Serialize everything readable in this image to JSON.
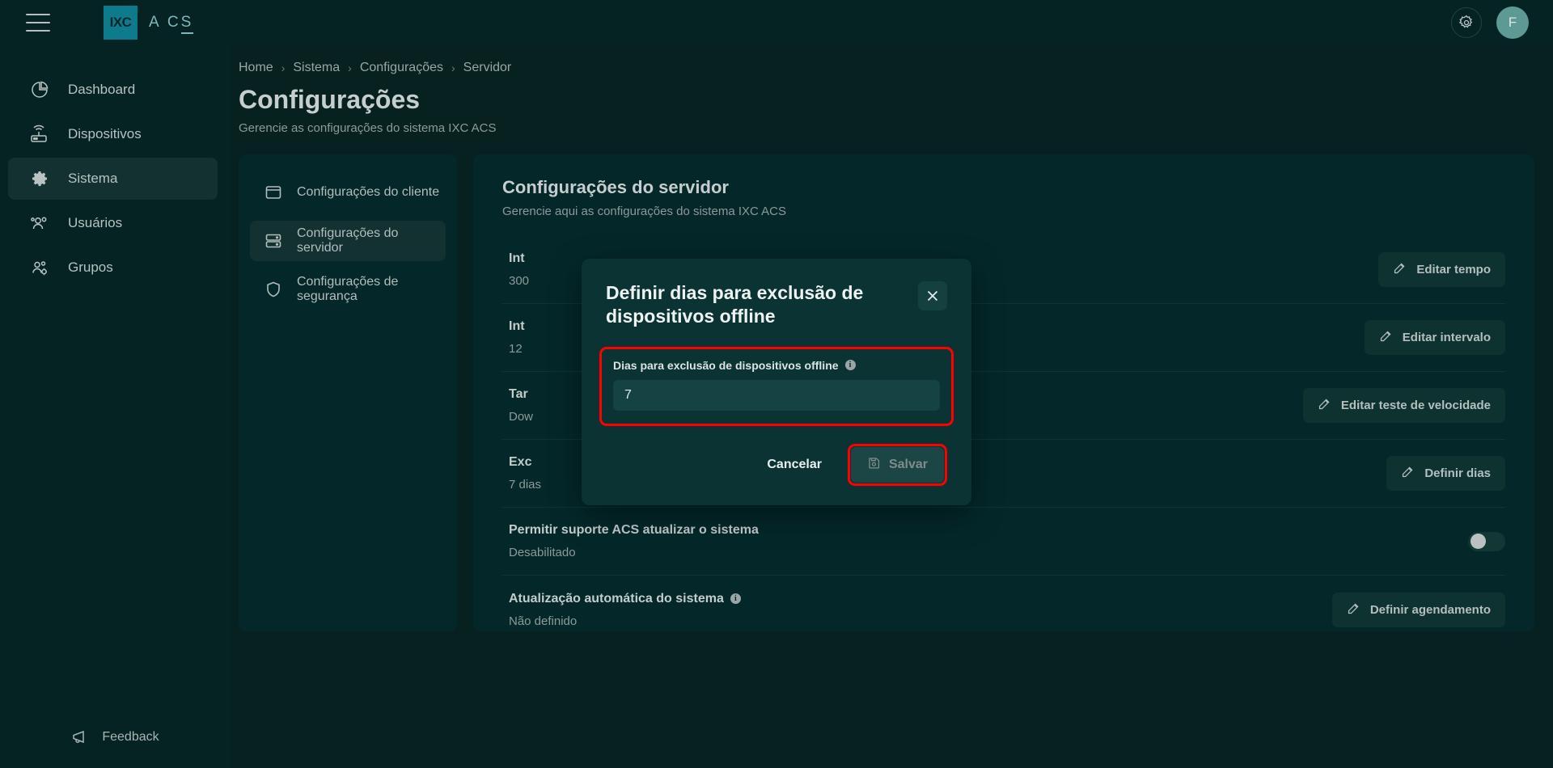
{
  "brand": {
    "logo_mark": "IXC",
    "logo_text_a": "A",
    "logo_text_b": "C",
    "logo_text_c": "S",
    "accent": "#0d7b8c"
  },
  "topbar": {
    "menu_icon": "hamburger-icon",
    "settings_icon": "gear-icon",
    "avatar_initial": "F"
  },
  "sidebar": {
    "items": [
      {
        "label": "Dashboard",
        "icon": "pie-chart-icon",
        "active": false
      },
      {
        "label": "Dispositivos",
        "icon": "router-icon",
        "active": false
      },
      {
        "label": "Sistema",
        "icon": "gear-icon",
        "active": true
      },
      {
        "label": "Usuários",
        "icon": "users-icon",
        "active": false
      },
      {
        "label": "Grupos",
        "icon": "users-gear-icon",
        "active": false
      }
    ],
    "feedback_label": "Feedback",
    "feedback_icon": "megaphone-icon"
  },
  "breadcrumb": {
    "items": [
      "Home",
      "Sistema",
      "Configurações",
      "Servidor"
    ],
    "separator": "›"
  },
  "page": {
    "title": "Configurações",
    "subtitle": "Gerencie as configurações do sistema IXC ACS"
  },
  "settings_nav": {
    "items": [
      {
        "label": "Configurações do cliente",
        "icon": "window-icon",
        "active": false
      },
      {
        "label": "Configurações do servidor",
        "icon": "server-icon",
        "active": true
      },
      {
        "label": "Configurações de segurança",
        "icon": "shield-icon",
        "active": false
      }
    ]
  },
  "panel": {
    "title": "Configurações do servidor",
    "subtitle": "Gerencie aqui as configurações do sistema IXC ACS",
    "rows": [
      {
        "label": "Int",
        "value": "300",
        "label_full": "Intervalo de tempo",
        "has_info": false,
        "action": {
          "type": "button",
          "label": "Editar tempo",
          "icon": "edit-icon"
        }
      },
      {
        "label": "Int",
        "value": "12 ",
        "label_full": "Intervalo",
        "has_info": false,
        "action": {
          "type": "button",
          "label": "Editar intervalo",
          "icon": "edit-icon"
        }
      },
      {
        "label": "Tar",
        "value": "Dow",
        "label_full": "Tarefa de teste de velocidade",
        "has_info": false,
        "action": {
          "type": "button",
          "label": "Editar teste de velocidade",
          "icon": "edit-icon"
        }
      },
      {
        "label": "Exc",
        "value": "7 dias",
        "label_full": "Exclusão de dispositivos offline",
        "has_info": false,
        "action": {
          "type": "button",
          "label": "Definir dias",
          "icon": "edit-icon"
        }
      },
      {
        "label": "Permitir suporte ACS atualizar o sistema",
        "value": "Desabilitado",
        "label_full": "Permitir suporte ACS atualizar o sistema",
        "has_info": false,
        "action": {
          "type": "toggle",
          "state": "off"
        }
      },
      {
        "label": "Atualização automática do sistema",
        "value": "Não definido",
        "label_full": "Atualização automática do sistema",
        "has_info": true,
        "action": {
          "type": "button",
          "label": "Definir agendamento",
          "icon": "edit-icon"
        }
      }
    ]
  },
  "modal": {
    "title": "Definir dias para exclusão de dispositivos offline",
    "close_icon": "close-icon",
    "field_label": "Dias para exclusão de dispositivos offline",
    "field_has_info": true,
    "field_value": "7",
    "cancel_label": "Cancelar",
    "save_label": "Salvar",
    "save_icon": "save-icon",
    "save_disabled": true,
    "highlight_color": "#ff0000"
  }
}
